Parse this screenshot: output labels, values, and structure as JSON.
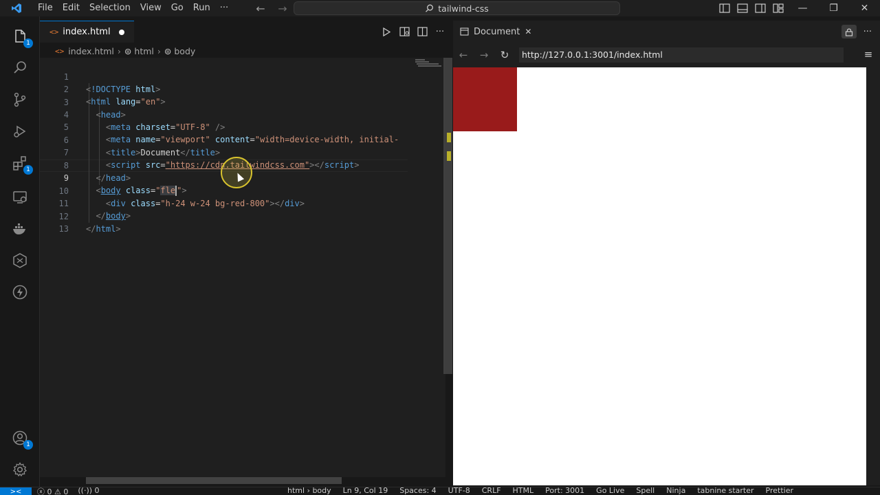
{
  "titlebar": {
    "menu": [
      "File",
      "Edit",
      "Selection",
      "View",
      "Go",
      "Run",
      "···"
    ],
    "search": "tailwind-css"
  },
  "activity": {
    "explorer_badge": "1",
    "extensions_badge": "1",
    "accounts_badge": "1"
  },
  "editor": {
    "tab_label": "index.html",
    "breadcrumb": [
      "index.html",
      "html",
      "body"
    ],
    "lines": [
      {
        "n": "1"
      },
      {
        "n": "2"
      },
      {
        "n": "3"
      },
      {
        "n": "4"
      },
      {
        "n": "5"
      },
      {
        "n": "6"
      },
      {
        "n": "7"
      },
      {
        "n": "8"
      },
      {
        "n": "9"
      },
      {
        "n": "10"
      },
      {
        "n": "11"
      },
      {
        "n": "12"
      },
      {
        "n": "13"
      }
    ],
    "code": {
      "l1_doctype": "!DOCTYPE",
      "l1_html": "html",
      "l2_tag": "html",
      "l2_attr": "lang",
      "l2_val": "\"en\"",
      "l3_tag": "head",
      "l4_tag": "meta",
      "l4_attr": "charset",
      "l4_val": "\"UTF-8\"",
      "l5_tag": "meta",
      "l5_attr1": "name",
      "l5_val1": "\"viewport\"",
      "l5_attr2": "content",
      "l5_val2": "\"width=device-width, initial-",
      "l6_tag": "title",
      "l6_text": "Document",
      "l6_close": "title",
      "l7_tag": "script",
      "l7_attr": "src",
      "l7_val": "\"https://cdn.tailwindcss.com\"",
      "l7_close": "script",
      "l8_tag": "head",
      "l9_tag": "body",
      "l9_attr": "class",
      "l9_val_open": "\"",
      "l9_val_sel": "fle",
      "l9_val_close": "\"",
      "l10_tag": "div",
      "l10_attr": "class",
      "l10_val": "\"h-24 w-24 bg-red-800\"",
      "l10_close": "div",
      "l11_tag": "body",
      "l12_tag": "html"
    }
  },
  "browser": {
    "tab_label": "Document",
    "url": "http://127.0.0.1:3001/index.html",
    "box_color": "#991b1b"
  },
  "status": {
    "errors": "0",
    "warnings": "0",
    "ports": "0",
    "items": [
      "html › body",
      "Ln 9, Col 19",
      "Spaces: 4",
      "UTF-8",
      "CRLF",
      "HTML",
      "Port: 3001",
      "Go Live",
      "Spell",
      "Ninja",
      "tabnine starter",
      "Prettier"
    ]
  }
}
